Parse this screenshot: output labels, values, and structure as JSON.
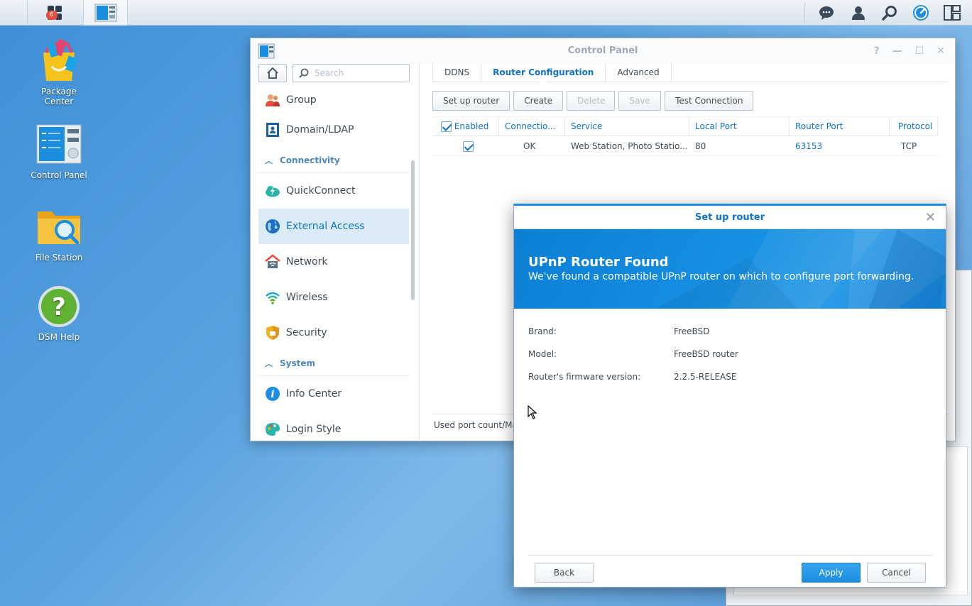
{
  "taskbar": {
    "notification_count": "6"
  },
  "desktop": {
    "icons": [
      {
        "label": "Package\nCenter"
      },
      {
        "label": "Control Panel"
      },
      {
        "label": "File Station"
      },
      {
        "label": "DSM Help"
      }
    ]
  },
  "control_panel": {
    "title": "Control Panel",
    "search_placeholder": "Search",
    "sidebar": {
      "group": "Group",
      "domain": "Domain/LDAP",
      "connectivity_header": "Connectivity",
      "quickconnect": "QuickConnect",
      "external_access": "External Access",
      "network": "Network",
      "wireless": "Wireless",
      "security": "Security",
      "system_header": "System",
      "info_center": "Info Center",
      "login_style": "Login Style"
    },
    "tabs": [
      "DDNS",
      "Router Configuration",
      "Advanced"
    ],
    "toolbar": {
      "setup": "Set up router",
      "create": "Create",
      "delete": "Delete",
      "save": "Save",
      "test": "Test Connection"
    },
    "grid": {
      "headers": [
        "Enabled",
        "Connectio...",
        "Service",
        "Local Port",
        "Router Port",
        "Protocol"
      ],
      "rows": [
        {
          "connection": "OK",
          "service": "Web Station, Photo Statio...",
          "local_port": "80",
          "router_port": "63153",
          "protocol": "TCP"
        }
      ]
    },
    "status_text": "Used port count/Ma"
  },
  "dialog": {
    "title": "Set up router",
    "banner_title": "UPnP Router Found",
    "banner_subtitle": "We've found a compatible UPnP router on which to configure port forwarding.",
    "fields": {
      "brand_label": "Brand:",
      "brand_value": "FreeBSD",
      "model_label": "Model:",
      "model_value": "FreeBSD router",
      "firmware_label": "Router's firmware version:",
      "firmware_value": "2.2.5-RELEASE"
    },
    "buttons": {
      "back": "Back",
      "apply": "Apply",
      "cancel": "Cancel"
    }
  },
  "colors": {
    "accent": "#0f73c5",
    "primary_button": "#1c8ee0",
    "banner": "#1891e3"
  }
}
